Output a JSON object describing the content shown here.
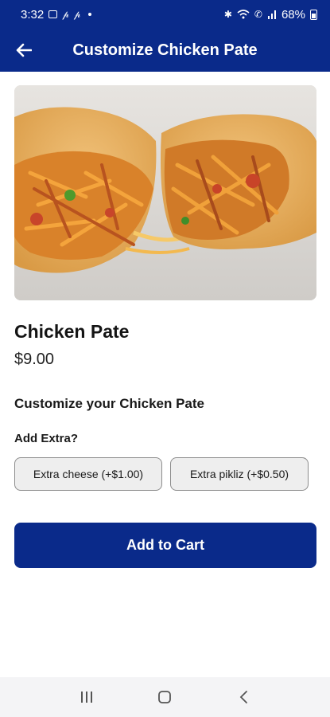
{
  "status_bar": {
    "time": "3:32",
    "battery": "68%",
    "left_icons": [
      "gallery-icon",
      "pinterest-icon",
      "pinterest-icon"
    ],
    "right_icons": [
      "bluetooth-icon",
      "wifi-icon",
      "call-icon",
      "signal-icon",
      "battery-icon"
    ]
  },
  "app_bar": {
    "title": "Customize Chicken Pate",
    "back_icon": "back-arrow-icon",
    "color": "#0a2a8a"
  },
  "product": {
    "name": "Chicken Pate",
    "price": "$9.00"
  },
  "customize": {
    "heading": "Customize your Chicken Pate",
    "extra_label": "Add Extra?",
    "options": [
      {
        "label": "Extra cheese (+$1.00)"
      },
      {
        "label": "Extra pikliz (+$0.50)"
      }
    ]
  },
  "cart_button": {
    "label": "Add to Cart"
  },
  "nav_bar": {
    "icons": [
      "recent-apps-icon",
      "home-icon",
      "back-icon"
    ]
  }
}
